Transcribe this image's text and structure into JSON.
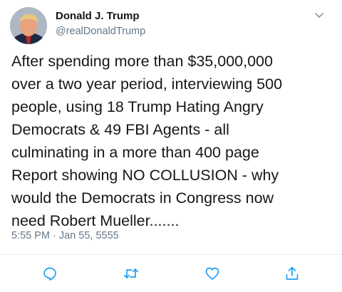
{
  "author": {
    "display_name": "Donald J. Trump",
    "handle": "@realDonaldTrump",
    "avatar_icon": "profile-photo"
  },
  "tweet": {
    "lines": [
      "After spending more than $35,000,000",
      "over a two year period, interviewing 500",
      "people, using 18 Trump Hating Angry",
      "Democrats & 49 FBI Agents - all",
      "culminating in a more than 400 page",
      "Report showing NO COLLUSION - why",
      "would the Democrats in Congress now",
      "need Robert Mueller......."
    ],
    "timestamp": "5:55 PM · Jan 55, 5555"
  },
  "actions": {
    "reply_icon": "reply-icon",
    "retweet_icon": "retweet-icon",
    "like_icon": "like-icon",
    "share_icon": "share-icon"
  },
  "colors": {
    "text": "#14171a",
    "secondary": "#657786",
    "icon": "#1da1f2",
    "divider": "#e6ecf0"
  }
}
